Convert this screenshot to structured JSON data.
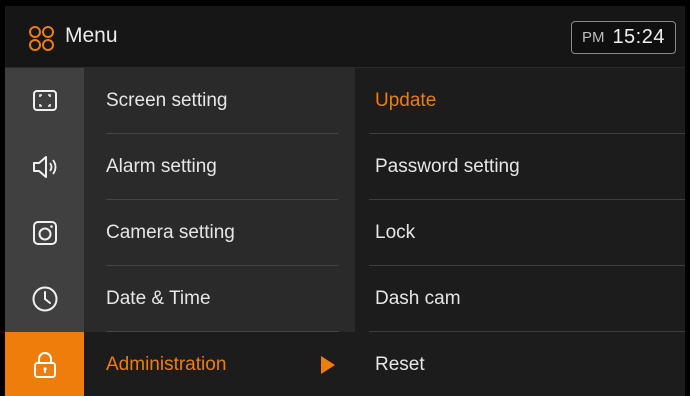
{
  "header": {
    "icon": "menu-circles-icon",
    "title": "Menu",
    "clock": {
      "ampm": "PM",
      "time": "15:24"
    }
  },
  "colors": {
    "accent": "#ef7d0c",
    "rail": "#404040",
    "middle_panel": "#2a2a2a",
    "background": "#1c1c1c"
  },
  "rail": [
    {
      "icon": "screen-icon"
    },
    {
      "icon": "speaker-icon"
    },
    {
      "icon": "camera-icon"
    },
    {
      "icon": "clock-icon"
    },
    {
      "icon": "lock-icon",
      "active": true
    }
  ],
  "categories": [
    {
      "label": "Screen setting"
    },
    {
      "label": "Alarm setting"
    },
    {
      "label": "Camera setting"
    },
    {
      "label": "Date & Time"
    },
    {
      "label": "Administration",
      "active": true
    }
  ],
  "submenu": [
    {
      "label": "Update",
      "highlight": true
    },
    {
      "label": "Password setting"
    },
    {
      "label": "Lock"
    },
    {
      "label": "Dash cam"
    },
    {
      "label": "Reset"
    }
  ]
}
